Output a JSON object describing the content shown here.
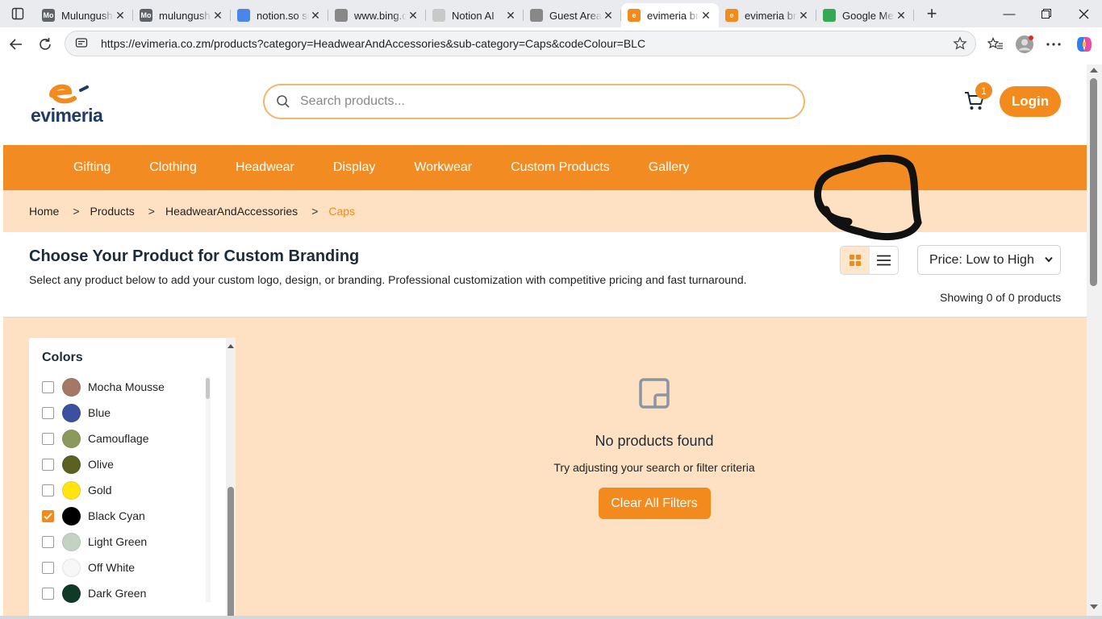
{
  "browser": {
    "tabs": [
      {
        "title": "Mulungushi",
        "favicon_color": "#5f6368",
        "favicon_text": "Mo"
      },
      {
        "title": "mulungushi",
        "favicon_color": "#5f6368",
        "favicon_text": "Mo"
      },
      {
        "title": "notion.so si",
        "favicon_color": "#4a86e8",
        "favicon_text": ""
      },
      {
        "title": "www.bing.c",
        "favicon_color": "#888888",
        "favicon_text": ""
      },
      {
        "title": "Notion AI",
        "favicon_color": "#c8c8c8",
        "favicon_text": ""
      },
      {
        "title": "Guest Area",
        "favicon_color": "#888888",
        "favicon_text": ""
      },
      {
        "title": "evimeria br",
        "favicon_color": "#f28a1e",
        "favicon_text": "e",
        "active": true
      },
      {
        "title": "evimeria br",
        "favicon_color": "#f28a1e",
        "favicon_text": "e"
      },
      {
        "title": "Google Me",
        "favicon_color": "#34a853",
        "favicon_text": ""
      }
    ],
    "url": "https://evimeria.co.zm/products?category=HeadwearAndAccessories&sub-category=Caps&codeColour=BLC"
  },
  "header": {
    "logo_text": "evimeria",
    "search_placeholder": "Search products...",
    "cart_count": "1",
    "login_label": "Login"
  },
  "nav": {
    "items": [
      "Gifting",
      "Clothing",
      "Headwear",
      "Display",
      "Workwear",
      "Custom Products",
      "Gallery"
    ]
  },
  "breadcrumb": {
    "items": [
      "Home",
      "Products",
      "HeadwearAndAccessories"
    ],
    "current": "Caps",
    "separator": ">"
  },
  "title_section": {
    "heading": "Choose Your Product for Custom Branding",
    "description": "Select any product below to add your custom logo, design, or branding. Professional customization with competitive pricing and fast turnaround.",
    "sort_selected": "Price: Low to High",
    "showing_text": "Showing 0 of 0 products",
    "view_mode": "grid"
  },
  "filters": {
    "title": "Colors",
    "colors": [
      {
        "name": "Mocha Mousse",
        "swatch": "#a47864",
        "checked": false
      },
      {
        "name": "Blue",
        "swatch": "#3d4f9f",
        "checked": false
      },
      {
        "name": "Camouflage",
        "swatch": "#8a9a5b",
        "checked": false
      },
      {
        "name": "Olive",
        "swatch": "#5b6121",
        "checked": false
      },
      {
        "name": "Gold",
        "swatch": "#ffe313",
        "checked": false
      },
      {
        "name": "Black Cyan",
        "swatch": "#000000",
        "checked": true
      },
      {
        "name": "Light Green",
        "swatch": "#c4d2c4",
        "checked": false
      },
      {
        "name": "Off White",
        "swatch": "#f7f7f7",
        "checked": false
      },
      {
        "name": "Dark Green",
        "swatch": "#0f3b26",
        "checked": false
      }
    ]
  },
  "empty_state": {
    "title": "No products found",
    "subtitle": "Try adjusting your search or filter criteria",
    "button": "Clear All Filters"
  },
  "colors": {
    "brand_orange": "#f28a1e",
    "nav_orange": "#f28c22",
    "peach_bg": "#fde1c2",
    "logo_navy": "#1f3a64"
  }
}
